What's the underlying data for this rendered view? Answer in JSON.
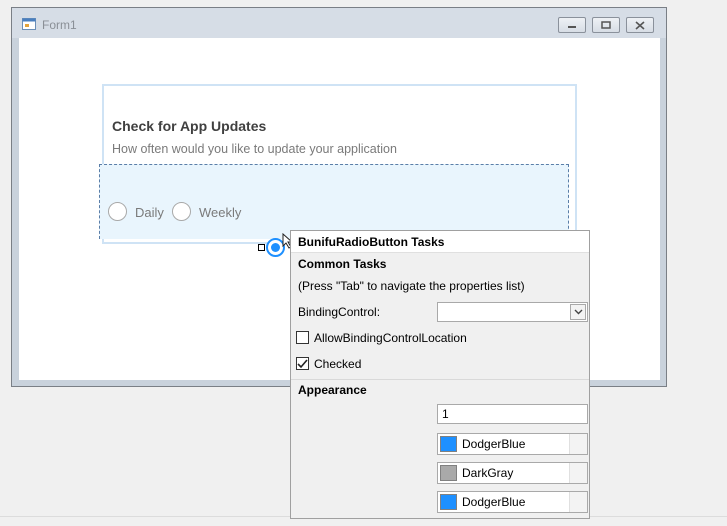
{
  "window": {
    "title": "Form1"
  },
  "card": {
    "title": "Check for App Updates",
    "subtitle": "How often would you like to update your application"
  },
  "radio_options": {
    "daily": "Daily",
    "weekly": "Weekly"
  },
  "tasks_panel": {
    "title": "BunifuRadioButton Tasks",
    "common_heading": "Common Tasks",
    "hint": "(Press \"Tab\" to navigate the properties list)",
    "binding_control_label": "BindingControl:",
    "binding_control_value": "",
    "allow_binding_label": "AllowBindingControlLocation",
    "allow_binding_checked": false,
    "checked_label": "Checked",
    "checked_checked": true,
    "appearance_heading": "Appearance",
    "border_thickness_value": "1",
    "colors": [
      {
        "name": "DodgerBlue",
        "hex": "#1e90ff"
      },
      {
        "name": "DarkGray",
        "hex": "#a9a9a9"
      },
      {
        "name": "DodgerBlue",
        "hex": "#1e90ff"
      }
    ]
  },
  "icons": {
    "form_icon": "form-icon",
    "minimize": "minimize-icon",
    "maximize": "maximize-icon",
    "close": "close-icon",
    "dropdown": "chevron-down-icon",
    "check": "checkmark-icon",
    "smart_tag": "smart-tag-arrow-icon"
  },
  "colors": {
    "accent": "#1e90ff",
    "panel_background": "#f0f0f0",
    "selection_background": "#e9f5fd"
  }
}
